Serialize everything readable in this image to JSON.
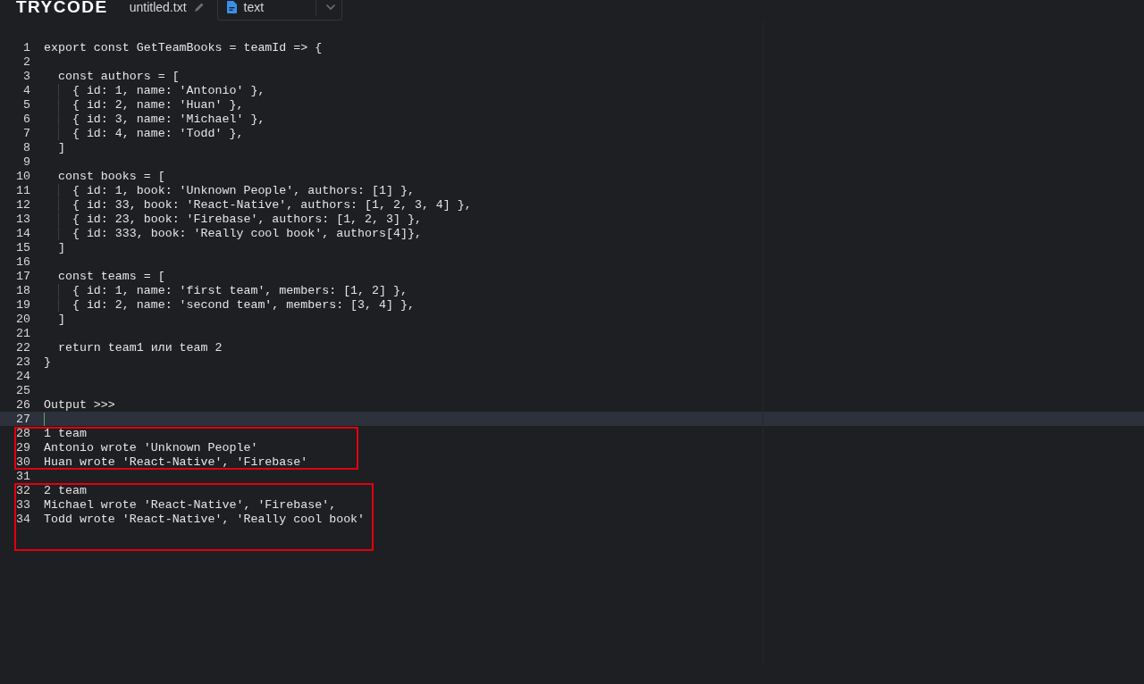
{
  "header": {
    "logo": "TRYCODE",
    "file_name": "untitled.txt",
    "language": "text"
  },
  "editor": {
    "lines": [
      {
        "number": "1",
        "text": "export const GetTeamBooks = teamId => {",
        "current": false
      },
      {
        "number": "2",
        "current": false
      },
      {
        "number": "3",
        "text": "  const authors = [",
        "current": false
      },
      {
        "number": "4",
        "text": "    { id: 1, name: 'Antonio' },",
        "current": false
      },
      {
        "number": "5",
        "text": "    { id: 2, name: 'Huan' },",
        "current": false
      },
      {
        "number": "6",
        "text": "    { id: 3, name: 'Michael' },",
        "current": false
      },
      {
        "number": "7",
        "text": "    { id: 4, name: 'Todd' },",
        "current": false
      },
      {
        "number": "8",
        "text": "  ]",
        "current": false
      },
      {
        "number": "9",
        "current": false
      },
      {
        "number": "10",
        "text": "  const books = [",
        "current": false
      },
      {
        "number": "11",
        "text": "    { id: 1, book: 'Unknown People', authors: [1] },",
        "current": false
      },
      {
        "number": "12",
        "text": "    { id: 33, book: 'React-Native', authors: [1, 2, 3, 4] },",
        "current": false
      },
      {
        "number": "13",
        "text": "    { id: 23, book: 'Firebase', authors: [1, 2, 3] },",
        "current": false
      },
      {
        "number": "14",
        "text": "    { id: 333, book: 'Really cool book', authors[4]},",
        "current": false
      },
      {
        "number": "15",
        "text": "  ]",
        "current": false
      },
      {
        "number": "16",
        "current": false
      },
      {
        "number": "17",
        "text": "  const teams = [",
        "current": false
      },
      {
        "number": "18",
        "text": "    { id: 1, name: 'first team', members: [1, 2] },",
        "current": false
      },
      {
        "number": "19",
        "text": "    { id: 2, name: 'second team', members: [3, 4] },",
        "current": false
      },
      {
        "number": "20",
        "text": "  ]",
        "current": false
      },
      {
        "number": "21",
        "current": false
      },
      {
        "number": "22",
        "text": "  return team1 или team 2",
        "current": false
      },
      {
        "number": "23",
        "text": "}",
        "current": false
      },
      {
        "number": "24",
        "current": false
      },
      {
        "number": "25",
        "current": false
      },
      {
        "number": "26",
        "text": "Output >>>",
        "current": false
      },
      {
        "number": "27",
        "current": true
      },
      {
        "number": "28",
        "text": "1 team",
        "current": false
      },
      {
        "number": "29",
        "text": "Antonio wrote 'Unknown People'",
        "current": false
      },
      {
        "number": "30",
        "text": "Huan wrote 'React-Native', 'Firebase'",
        "current": false
      },
      {
        "number": "31",
        "current": false
      },
      {
        "number": "32",
        "text": "2 team",
        "current": false
      },
      {
        "number": "33",
        "text": "Michael wrote 'React-Native', 'Firebase',",
        "current": false
      },
      {
        "number": "34",
        "text": "Todd wrote 'React-Native', 'Really cool book'",
        "current": false
      }
    ]
  },
  "annotations": [
    {
      "kind": "rectangle"
    },
    {
      "kind": "rectangle"
    }
  ]
}
